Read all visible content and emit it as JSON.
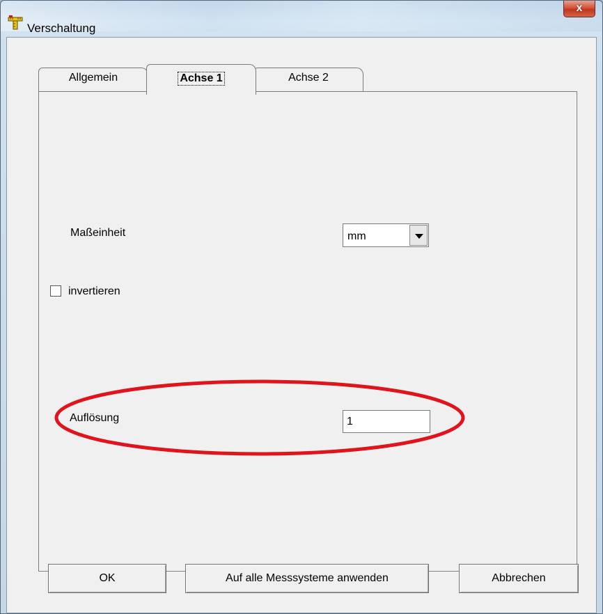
{
  "window": {
    "title": "Verschaltung",
    "icon": "ruler-icon",
    "close_label": "x"
  },
  "tabs": [
    {
      "label": "Allgemein",
      "active": false
    },
    {
      "label": "Achse 1",
      "active": true
    },
    {
      "label": "Achse 2",
      "active": false
    }
  ],
  "form": {
    "unit_label": "Maßeinheit",
    "unit_value": "mm",
    "invert_label": "invertieren",
    "invert_checked": false,
    "resolution_label": "Auflösung",
    "resolution_value": "1"
  },
  "annotation": {
    "highlight_color": "#e0141c"
  },
  "buttons": {
    "ok": "OK",
    "apply_all": "Auf alle Messsysteme anwenden",
    "cancel": "Abbrechen"
  }
}
